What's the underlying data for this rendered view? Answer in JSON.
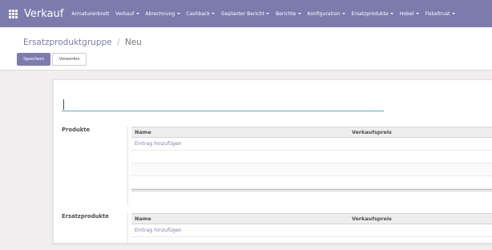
{
  "navbar": {
    "app_name": "Verkauf",
    "menu": [
      {
        "label": "Armaturenbrett",
        "dropdown": false
      },
      {
        "label": "Verkauf",
        "dropdown": true
      },
      {
        "label": "Abrechnung",
        "dropdown": true
      },
      {
        "label": "Cashback",
        "dropdown": true
      },
      {
        "label": "Geplanter Bericht",
        "dropdown": true
      },
      {
        "label": "Berichte",
        "dropdown": true
      },
      {
        "label": "Konfiguration",
        "dropdown": true
      },
      {
        "label": "Ersatzprodukte",
        "dropdown": true
      },
      {
        "label": "Hobel",
        "dropdown": true
      },
      {
        "label": "Fiskaltrust",
        "dropdown": true
      }
    ]
  },
  "breadcrumb": {
    "parent": "Ersatzproduktgruppe",
    "separator": "/",
    "current": "Neu"
  },
  "buttons": {
    "save": "Speichern",
    "discard": "Verwerfen"
  },
  "form": {
    "name_value": "",
    "products": {
      "label": "Produkte",
      "columns": [
        "Name",
        "Verkaufspreis"
      ],
      "add_line": "Eintrag hinzufügen"
    },
    "replacements": {
      "label": "Ersatzprodukte",
      "columns": [
        "Name",
        "Verkaufspreis"
      ],
      "add_line": "Eintrag hinzufügen"
    }
  },
  "colors": {
    "brand": "#7c7bad",
    "input_focus": "#64a0c8",
    "background": "#f0eeee"
  }
}
